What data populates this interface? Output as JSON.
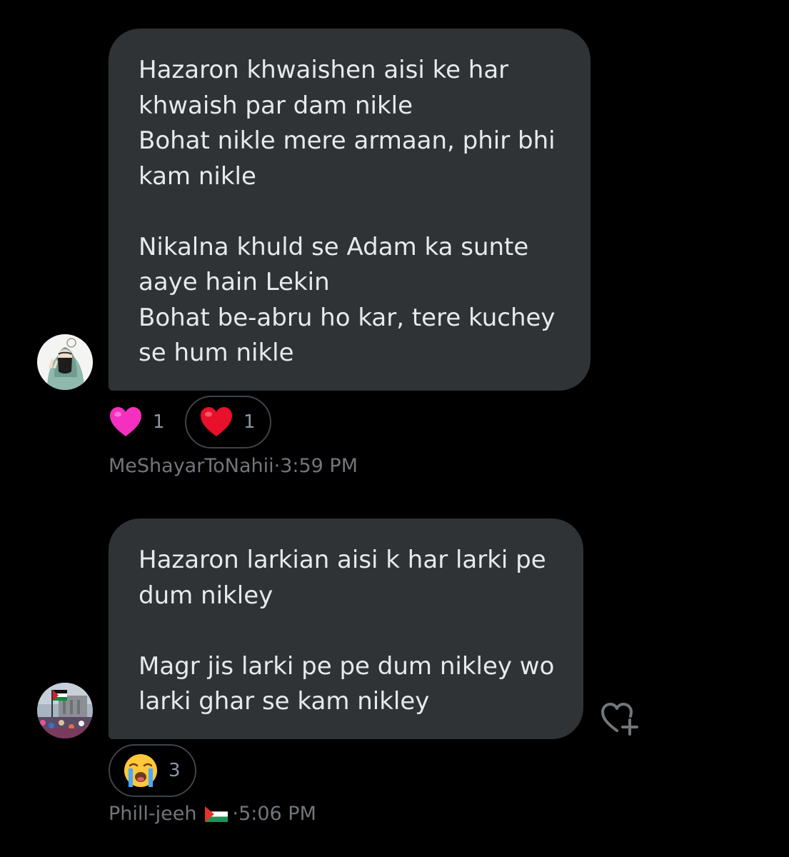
{
  "messages": [
    {
      "author": "MeShayarToNahii",
      "separator": " · ",
      "time": "3:59 PM",
      "lines": [
        "Hazaron khwaishen aisi ke har",
        "khwaish par dam nikle",
        "Bohat nikle mere armaan, phir bhi",
        "kam nikle",
        "",
        "Nikalna khuld se Adam ka sunte",
        "aaye hain Lekin",
        "Bohat be-abru ho kar, tere kuchey",
        "se hum nikle"
      ],
      "reactions": [
        {
          "emoji": "pink-heart",
          "count": "1",
          "selected": false
        },
        {
          "emoji": "red-heart",
          "count": "1",
          "selected": true
        }
      ]
    },
    {
      "author": "Phill-jeeh",
      "separator": " ·",
      "time": "5:06 PM",
      "flag": "palestine-flag",
      "lines": [
        "Hazaron larkian aisi k har larki pe",
        "dum nikley",
        "",
        "Magr jis larki pe pe dum nikley wo",
        "larki ghar se kam nikley"
      ],
      "reactions": [
        {
          "emoji": "loudly-crying-face",
          "count": "3",
          "selected": true
        }
      ]
    }
  ],
  "colors": {
    "background": "#000000",
    "bubble": "#2f3336",
    "text": "#e7e9ea",
    "meta": "#71767b",
    "reaction_border": "#3e4449"
  },
  "icons": {
    "add_reaction": "heart-plus-icon"
  }
}
